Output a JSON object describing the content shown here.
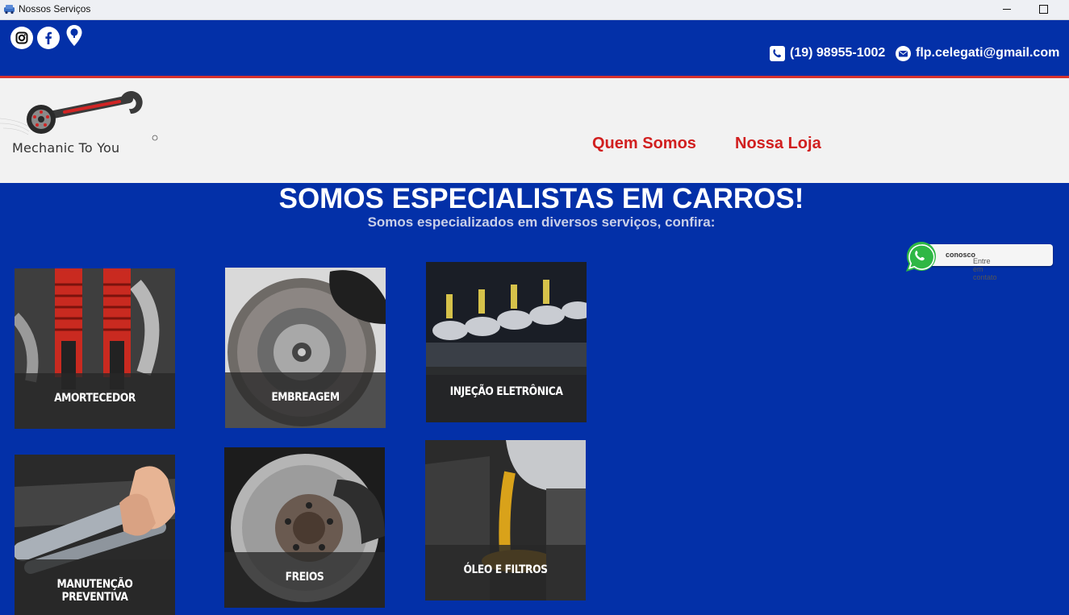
{
  "window": {
    "title": "Nossos Serviços"
  },
  "topbar": {
    "social_icons": [
      "instagram-icon",
      "facebook-icon",
      "location-pin-icon"
    ],
    "phone": "(19) 98955-1002",
    "email": "flp.celegati@gmail.com"
  },
  "header": {
    "logo_text": "Mechanic To You",
    "nav": {
      "quem_somos": "Quem Somos",
      "nossa_loja": "Nossa Loja"
    }
  },
  "hero": {
    "title": "SOMOS ESPECIALISTAS EM CARROS!",
    "subtitle": "Somos especializados em diversos serviços, confira:"
  },
  "whatsapp": {
    "label_prefix": "Entre em contato ",
    "label_bold": "conosco"
  },
  "services": [
    {
      "label": "AMORTECEDOR"
    },
    {
      "label": "EMBREAGEM"
    },
    {
      "label": "INJEÇÃO ELETRÔNICA"
    },
    {
      "label": "MANUTENÇÃO PREVENTIVA"
    },
    {
      "label": "FREIOS"
    },
    {
      "label": "ÓLEO E FILTROS"
    }
  ],
  "colors": {
    "brand_blue": "#0330a8",
    "nav_red": "#d11f1f",
    "accent_line": "#d6322f",
    "header_bg": "#f2f2f2"
  }
}
